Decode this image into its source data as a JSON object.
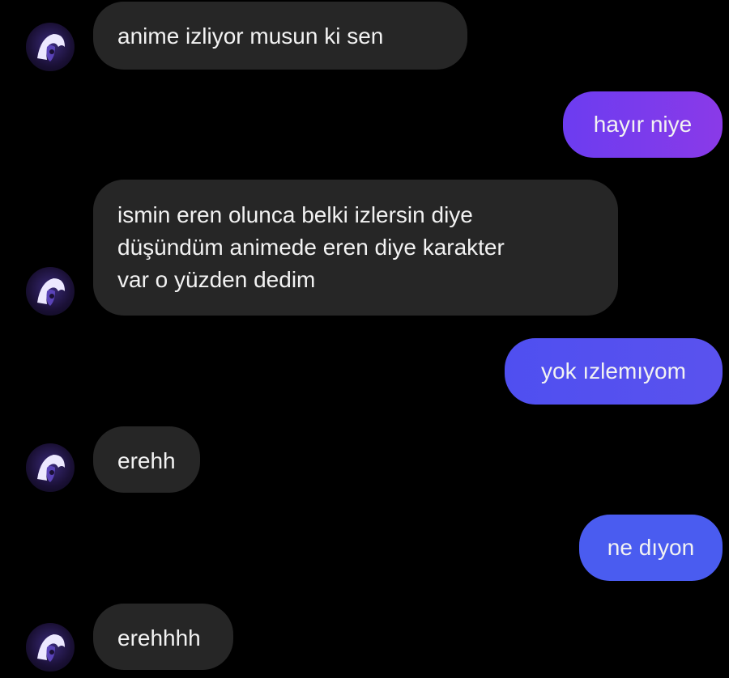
{
  "colors": {
    "background": "#000000",
    "incoming_bubble": "#262626",
    "outgoing_purple": "#7a3bf0",
    "outgoing_blue": "#4a5cf0",
    "text": "#f2f2f2"
  },
  "contact": {
    "avatar_icon": "anime-character-avatar-icon"
  },
  "messages": [
    {
      "sender": "them",
      "text": "anime izliyor musun ki sen"
    },
    {
      "sender": "me",
      "text": "hayır niye"
    },
    {
      "sender": "them",
      "lines": [
        "ismin eren olunca belki izlersin diye",
        "düşündüm animede eren diye karakter",
        "var o yüzden dedim"
      ]
    },
    {
      "sender": "me",
      "text": "yok ızlemıyom"
    },
    {
      "sender": "them",
      "text": "erehh"
    },
    {
      "sender": "me",
      "text": "ne dıyon"
    },
    {
      "sender": "them",
      "text": "erehhhh"
    }
  ]
}
